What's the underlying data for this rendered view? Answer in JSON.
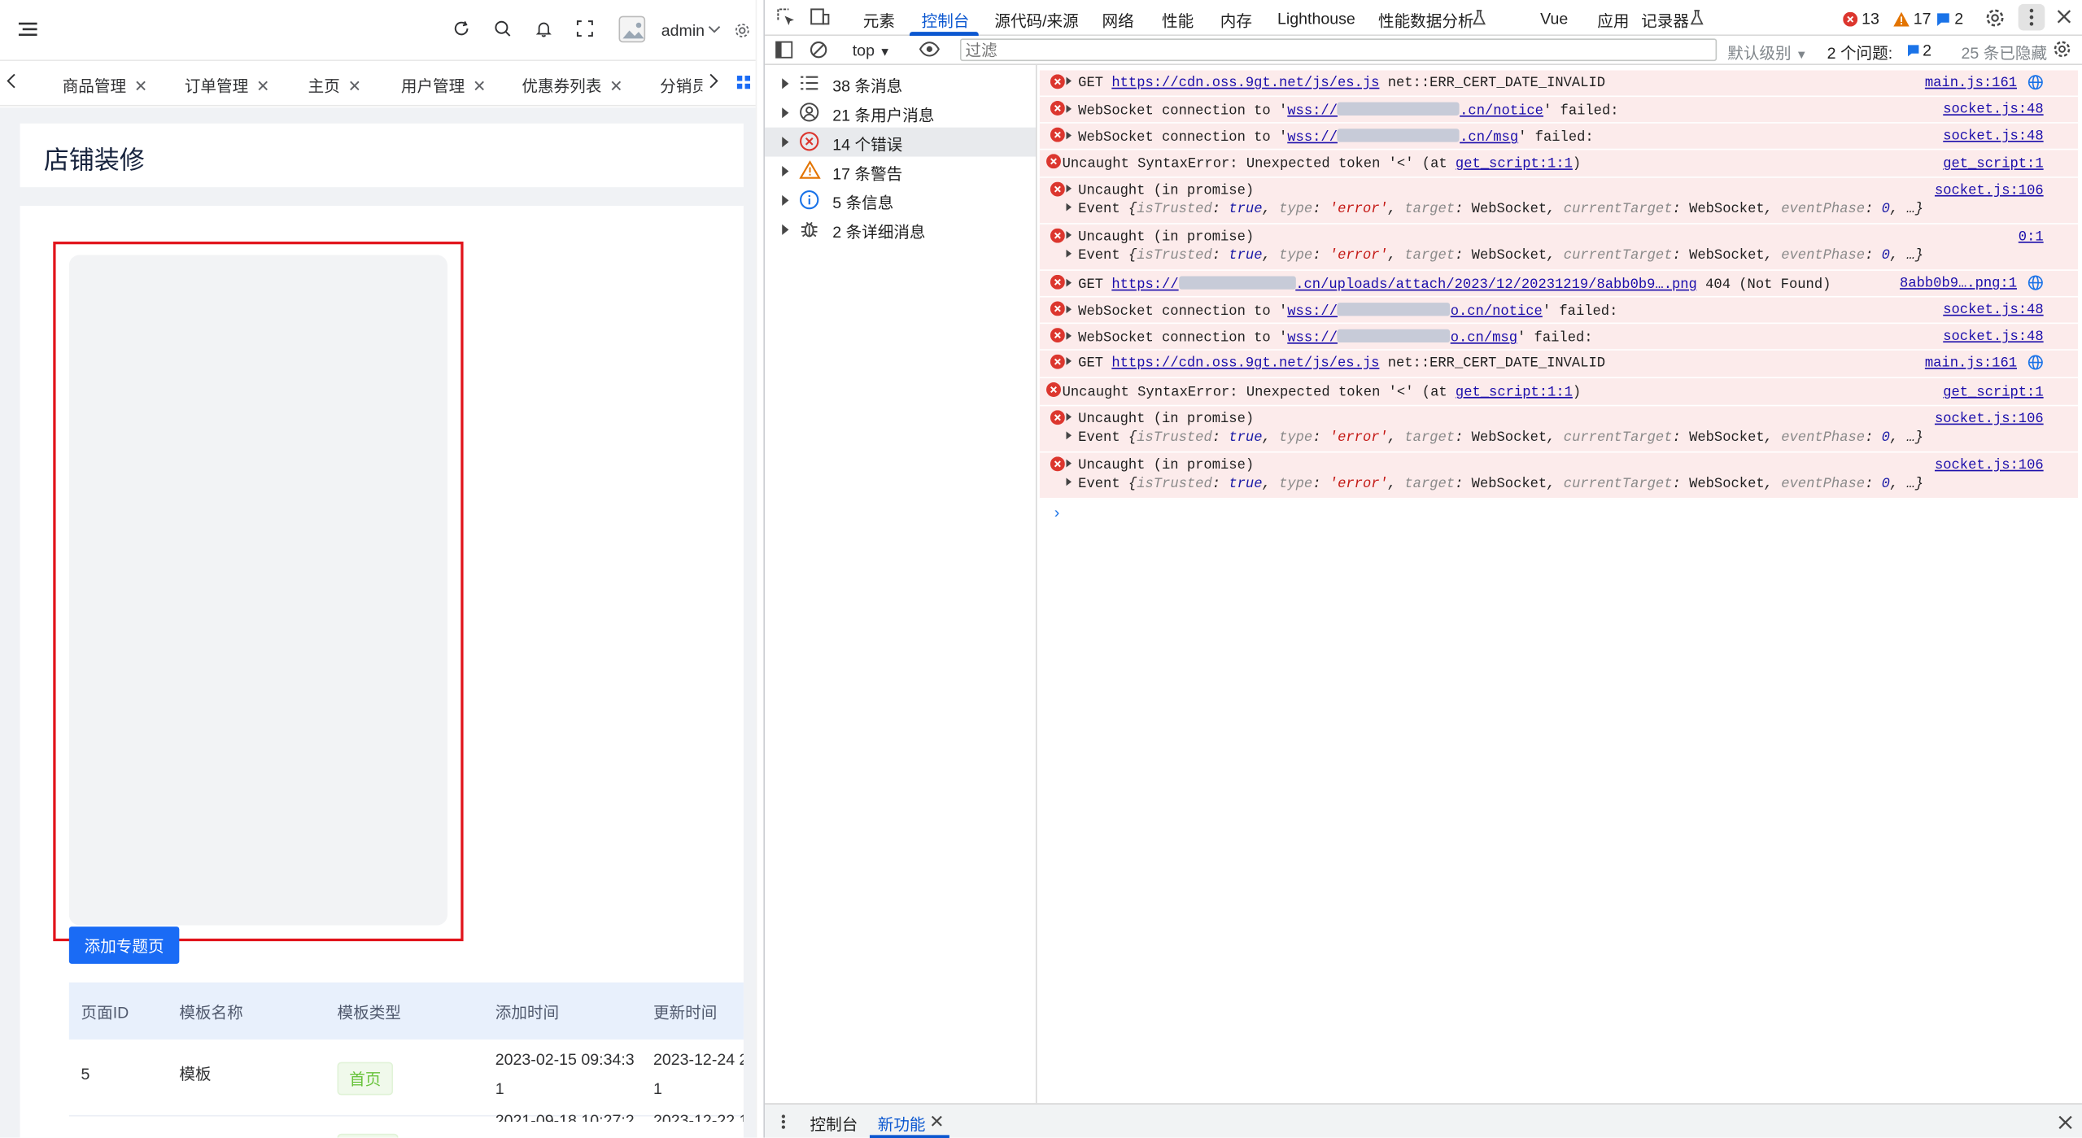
{
  "app": {
    "header": {
      "username": "admin"
    },
    "tabs": [
      {
        "label": "商品管理"
      },
      {
        "label": "订单管理"
      },
      {
        "label": "主页"
      },
      {
        "label": "用户管理"
      },
      {
        "label": "优惠券列表"
      },
      {
        "label": "分销员"
      }
    ],
    "page_title": "店铺装修",
    "add_button": "添加专题页",
    "table": {
      "columns": [
        "页面ID",
        "模板名称",
        "模板类型",
        "添加时间",
        "更新时间"
      ],
      "rows": [
        {
          "id": "5",
          "name": "模板",
          "type": "首页",
          "added_line1": "2023-02-15 09:34:3",
          "added_line2": "1",
          "updated_line1": "2023-12-24 2",
          "updated_line2": "1"
        }
      ],
      "partial_row": {
        "added": "2021-09-18 10:27:2",
        "updated": "2023-12-22 1"
      }
    }
  },
  "devtools": {
    "tabs": [
      "元素",
      "控制台",
      "源代码/来源",
      "网络",
      "性能",
      "内存",
      "Lighthouse",
      "性能数据分析",
      "Vue",
      "应用",
      "记录器"
    ],
    "active_tab": "控制台",
    "counts": {
      "errors": "13",
      "warnings": "17",
      "info": "2"
    },
    "toolbar": {
      "context": "top",
      "filter_placeholder": "过滤",
      "level": "默认级别",
      "issues": "2 个问题:",
      "issues_count": "2",
      "hidden": "25 条已隐藏"
    },
    "sidebar": [
      {
        "label": "38 条消息",
        "icon": "list-icon"
      },
      {
        "label": "21 条用户消息",
        "icon": "user-icon"
      },
      {
        "label": "14 个错误",
        "icon": "error-icon"
      },
      {
        "label": "17 条警告",
        "icon": "warning-icon"
      },
      {
        "label": "5 条信息",
        "icon": "info-icon"
      },
      {
        "label": "2 条详细消息",
        "icon": "bug-icon"
      }
    ],
    "entries": [
      {
        "pre": "GET ",
        "link": "https://cdn.oss.9gt.net/js/es.js",
        "post": " net::ERR_CERT_DATE_INVALID",
        "source": "main.js:161"
      },
      {
        "pre": "WebSocket connection to '",
        "link_pre": "wss://",
        "link_post": ".cn/notice",
        "post": "' failed:",
        "source": "socket.js:48"
      },
      {
        "pre": "WebSocket connection to '",
        "link_pre": "wss://",
        "link_post": ".cn/msg",
        "post": "' failed:",
        "source": "socket.js:48"
      },
      {
        "pre": "Uncaught SyntaxError: Unexpected token '<' (at ",
        "link": "get_script:1:1",
        "post": ")",
        "source": "get_script:1"
      },
      {
        "pre": "Uncaught (in promise)",
        "source": "socket.js:106"
      },
      {
        "pre": "Uncaught (in promise)",
        "source": "0:1"
      },
      {
        "pre": "GET ",
        "link_pre": "https://",
        "link_post": ".cn/uploads/attach/2023/12/20231219/8abb0b9….png",
        "post": " 404 (Not Found)",
        "source": "8abb0b9….png:1"
      },
      {
        "pre": "WebSocket connection to '",
        "link_pre": "wss://",
        "link_post": "o.cn/notice",
        "post": "' failed:",
        "source": "socket.js:48"
      },
      {
        "pre": "WebSocket connection to '",
        "link_pre": "wss://",
        "link_post": "o.cn/msg",
        "post": "' failed:",
        "source": "socket.js:48"
      },
      {
        "pre": "GET ",
        "link": "https://cdn.oss.9gt.net/js/es.js",
        "post": " net::ERR_CERT_DATE_INVALID",
        "source": "main.js:161"
      },
      {
        "pre": "Uncaught SyntaxError: Unexpected token '<' (at ",
        "link": "get_script:1:1",
        "post": ")",
        "source": "get_script:1"
      },
      {
        "pre": "Uncaught (in promise)",
        "source": "socket.js:106"
      },
      {
        "pre": "Uncaught (in promise)",
        "source": "socket.js:106"
      }
    ],
    "event": {
      "head": "Event ",
      "k1": "isTrusted",
      "v1": "true",
      "k2": "type",
      "v2": "'error'",
      "k3": "target",
      "v3": "WebSocket",
      "k4": "currentTarget",
      "v4": "WebSocket",
      "k5": "eventPhase",
      "v5": "0"
    },
    "prompt": "›",
    "bottom_tabs": [
      "控制台",
      "新功能"
    ]
  }
}
